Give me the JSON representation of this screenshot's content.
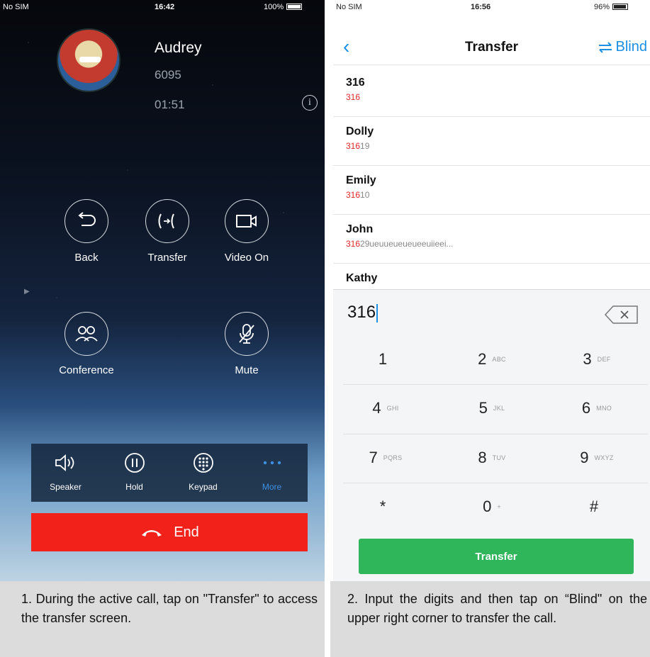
{
  "call_screen": {
    "status_bar": {
      "carrier": "No SIM",
      "time": "16:42",
      "battery": "100%"
    },
    "contact": {
      "name": "Audrey",
      "number": "6095",
      "duration": "01:51"
    },
    "buttons": {
      "back": "Back",
      "transfer": "Transfer",
      "video_on": "Video On",
      "conference": "Conference",
      "mute": "Mute"
    },
    "toolbar": {
      "speaker": "Speaker",
      "hold": "Hold",
      "keypad": "Keypad",
      "more": "More"
    },
    "end_label": "End",
    "colors": {
      "end": "#f2221b",
      "more_active": "#3d8fe0"
    }
  },
  "transfer_screen": {
    "status_bar": {
      "carrier": "No SIM",
      "time": "16:56",
      "battery": "96%"
    },
    "title": "Transfer",
    "blind_label": "Blind",
    "contacts": [
      {
        "name": "316",
        "match": "316",
        "rest": ""
      },
      {
        "name": "Dolly",
        "match": "316",
        "rest": "19"
      },
      {
        "name": "Emily",
        "match": "316",
        "rest": "10"
      },
      {
        "name": "John",
        "match": "316",
        "rest": "29ueuueueueueeuiieei..."
      },
      {
        "name": "Kathy",
        "match": "",
        "rest": ""
      }
    ],
    "entry": "316",
    "keypad": [
      {
        "digit": "1",
        "letters": ""
      },
      {
        "digit": "2",
        "letters": "ABC"
      },
      {
        "digit": "3",
        "letters": "DEF"
      },
      {
        "digit": "4",
        "letters": "GHI"
      },
      {
        "digit": "5",
        "letters": "JKL"
      },
      {
        "digit": "6",
        "letters": "MNO"
      },
      {
        "digit": "7",
        "letters": "PQRS"
      },
      {
        "digit": "8",
        "letters": "TUV"
      },
      {
        "digit": "9",
        "letters": "WXYZ"
      },
      {
        "digit": "*",
        "letters": ""
      },
      {
        "digit": "0",
        "letters": "+"
      },
      {
        "digit": "#",
        "letters": ""
      }
    ],
    "transfer_button": "Transfer",
    "colors": {
      "accent": "#1a8fe3",
      "match": "#e3262b",
      "transfer": "#2fb55a"
    }
  },
  "captions": {
    "step1": "1. During the active call, tap on \"Transfer\" to access the transfer screen.",
    "step2": "2. Input the digits and then tap on “Blind\" on the upper right corner to transfer the call."
  }
}
